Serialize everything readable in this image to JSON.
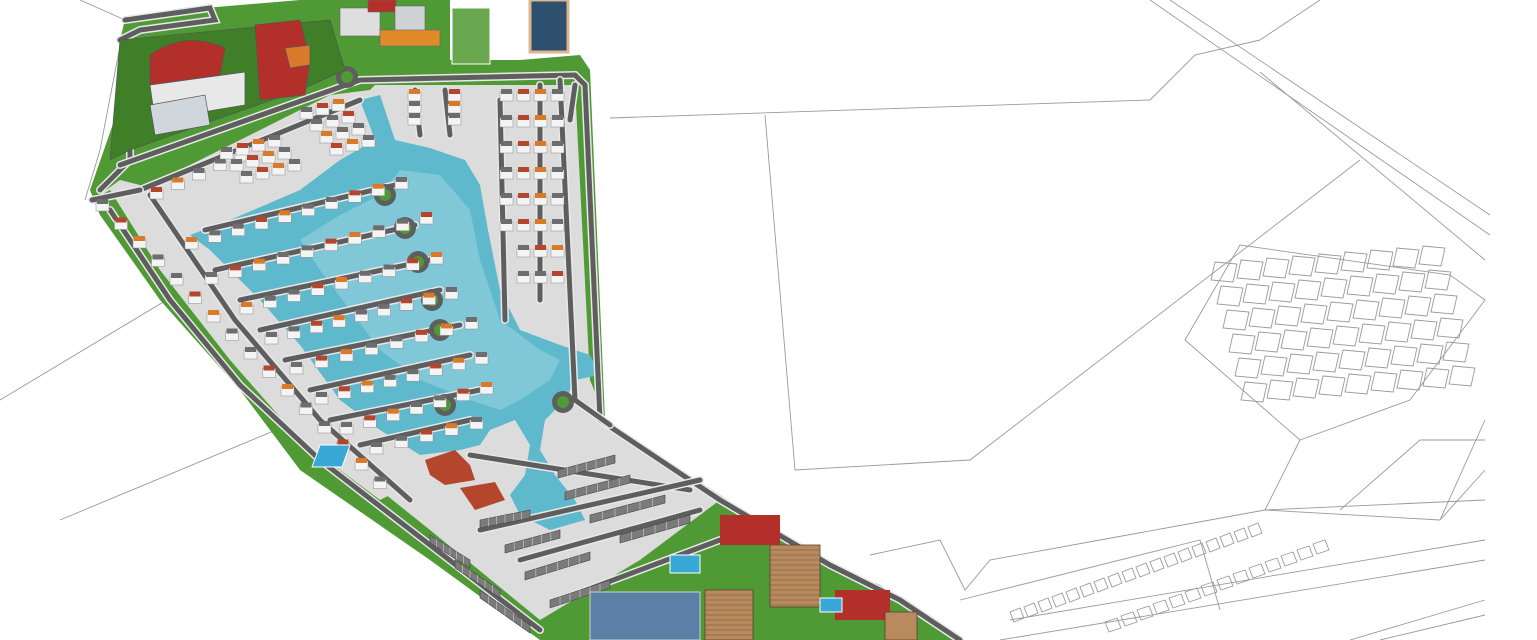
{
  "scene": {
    "kind": "masterplan-render",
    "colors": {
      "background": "#ffffff",
      "lawn": "#4f9a34",
      "lawn_dark": "#3f7f28",
      "road": "#5e5e5e",
      "road_edge": "#e8e8e8",
      "water": "#5fb9cc",
      "water_light": "#9ad6e2",
      "plot": "#dcdcdc",
      "house_roof_red": "#b5462e",
      "house_roof_orange": "#d97a2b",
      "house_roof_grey": "#6d6d6d",
      "tower": "#b88a5e",
      "tower_glass": "#2f4f6f",
      "civic_red": "#b3302a",
      "pool": "#39a8d6",
      "lineart": "#9a9a9a"
    }
  }
}
